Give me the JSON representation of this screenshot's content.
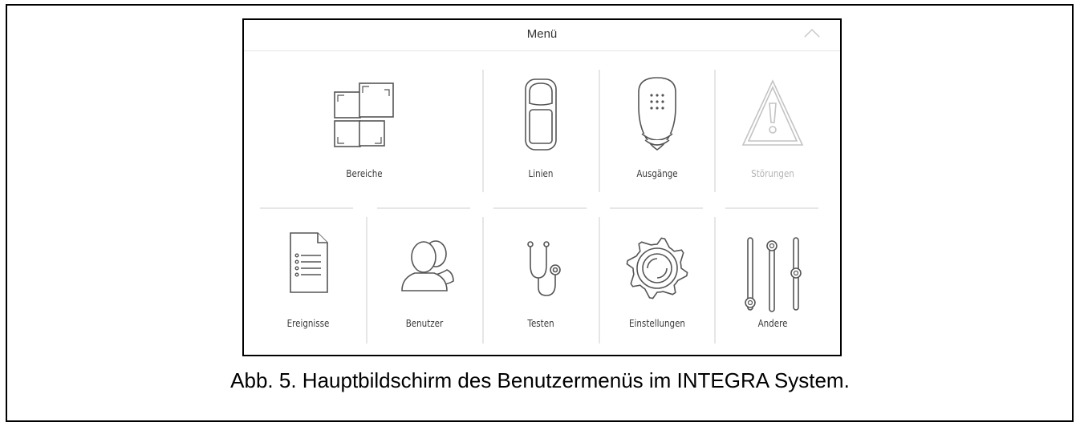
{
  "menu": {
    "title": "Menü",
    "collapse_icon": "chevron-up-icon"
  },
  "tiles": [
    {
      "label": "Bereiche",
      "icon": "partitions-icon",
      "enabled": true
    },
    {
      "label": "Linien",
      "icon": "zone-detector-icon",
      "enabled": true
    },
    {
      "label": "Ausgänge",
      "icon": "siren-output-icon",
      "enabled": true
    },
    {
      "label": "Störungen",
      "icon": "warning-triangle-icon",
      "enabled": false
    },
    {
      "label": "Ereignisse",
      "icon": "event-log-document-icon",
      "enabled": true
    },
    {
      "label": "Benutzer",
      "icon": "users-icon",
      "enabled": true
    },
    {
      "label": "Testen",
      "icon": "stethoscope-icon",
      "enabled": true
    },
    {
      "label": "Einstellungen",
      "icon": "gear-icon",
      "enabled": true
    },
    {
      "label": "Andere",
      "icon": "sliders-icon",
      "enabled": true
    }
  ],
  "colors": {
    "icon_stroke": "#555555",
    "disabled": "#b4b4b4",
    "separator": "#e6e6e6"
  },
  "caption": "Abb. 5. Hauptbildschirm des Benutzermenüs im INTEGRA System."
}
